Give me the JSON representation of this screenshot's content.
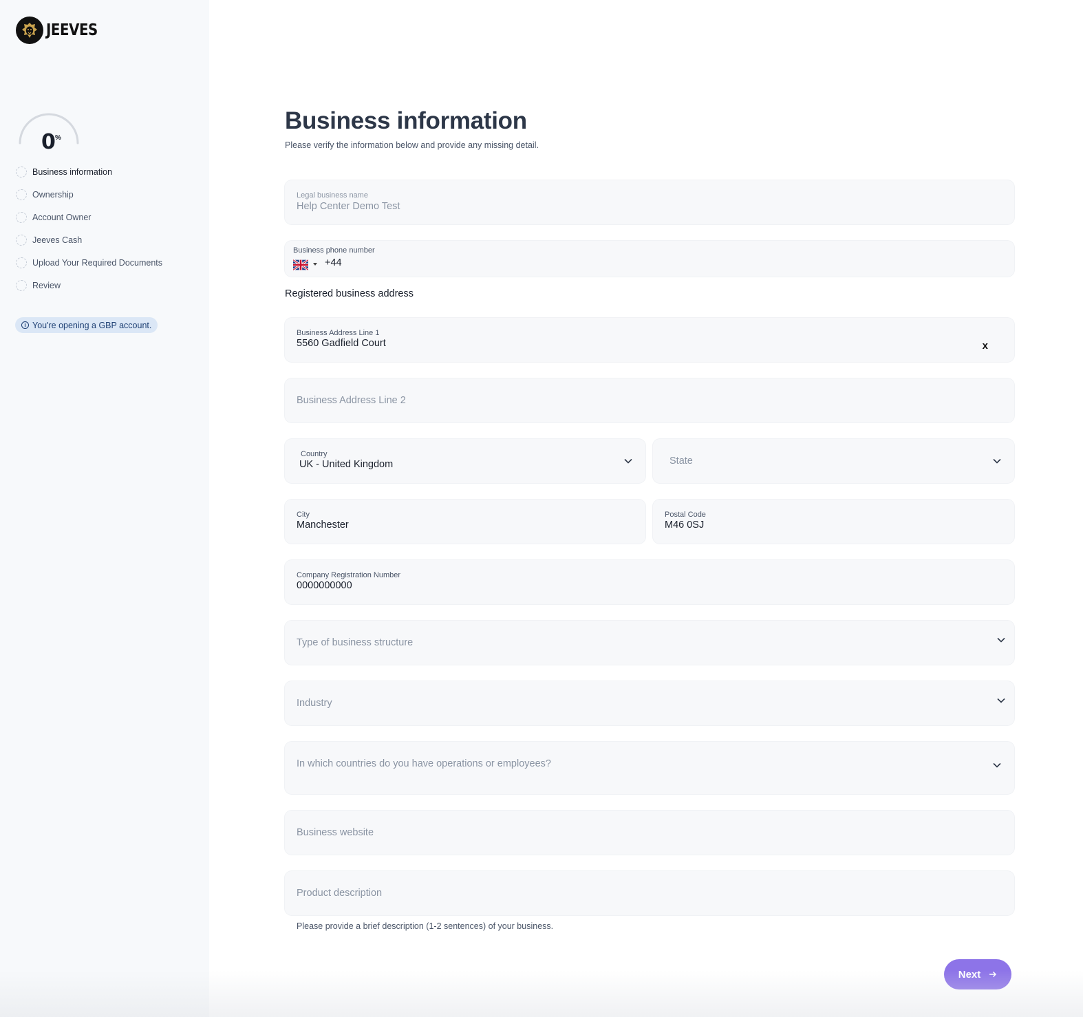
{
  "brand": {
    "name": "JEEVES"
  },
  "sidebar": {
    "progress": {
      "value": "0",
      "unit": "%",
      "fraction": 0
    },
    "steps": [
      {
        "label": "Business information",
        "active": true
      },
      {
        "label": "Ownership",
        "active": false
      },
      {
        "label": "Account Owner",
        "active": false
      },
      {
        "label": "Jeeves Cash",
        "active": false
      },
      {
        "label": "Upload Your Required Documents",
        "active": false
      },
      {
        "label": "Review",
        "active": false
      }
    ],
    "notice": {
      "icon": "info-icon",
      "text": "You're opening a GBP account."
    }
  },
  "page": {
    "title": "Business information",
    "subtitle": "Please verify the information below and provide any missing detail.",
    "address_section_label": "Registered business address"
  },
  "form": {
    "legal_name": {
      "label": "Legal business name",
      "value": "Help Center Demo Test"
    },
    "phone": {
      "label": "Business phone number",
      "flag": "uk-flag-icon",
      "code": "+44"
    },
    "address_line1": {
      "label": "Business Address Line 1",
      "value": "5560 Gadfield Court",
      "clear": "x"
    },
    "address_line2": {
      "placeholder": "Business Address Line 2"
    },
    "country": {
      "label": "Country",
      "value": "UK - United Kingdom"
    },
    "state": {
      "placeholder": "State"
    },
    "city": {
      "label": "City",
      "value": "Manchester"
    },
    "postal_code": {
      "label": "Postal Code",
      "value": "M46 0SJ"
    },
    "registration_number": {
      "label": "Company Registration Number",
      "value": "0000000000"
    },
    "business_structure": {
      "placeholder": "Type of business structure"
    },
    "industry": {
      "placeholder": "Industry"
    },
    "operations_countries": {
      "placeholder": "In which countries do you have operations or employees?"
    },
    "website": {
      "placeholder": "Business website"
    },
    "product_description": {
      "placeholder": "Product description",
      "helper": "Please provide a brief description (1-2 sentences) of your business."
    },
    "next_button": {
      "label": "Next"
    }
  },
  "colors": {
    "accent": "#8d74e8",
    "notice_bg": "#dbe7f6",
    "sidebar_bg": "#f7f9fb"
  }
}
